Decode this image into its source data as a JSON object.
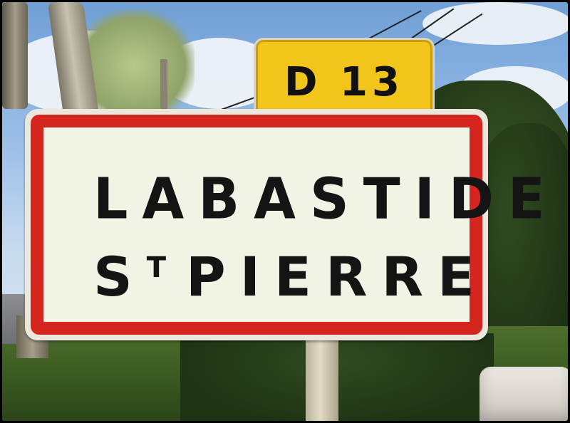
{
  "route_sign": {
    "text": "D 13",
    "background_color": "#f2c51b"
  },
  "town_sign": {
    "line1": "LABASTIDE",
    "line2_prefix": "S",
    "line2_superscript": "T",
    "line2_main": "PIERRE",
    "border_color": "#d4261f",
    "background_color": "#f1f3e4"
  }
}
